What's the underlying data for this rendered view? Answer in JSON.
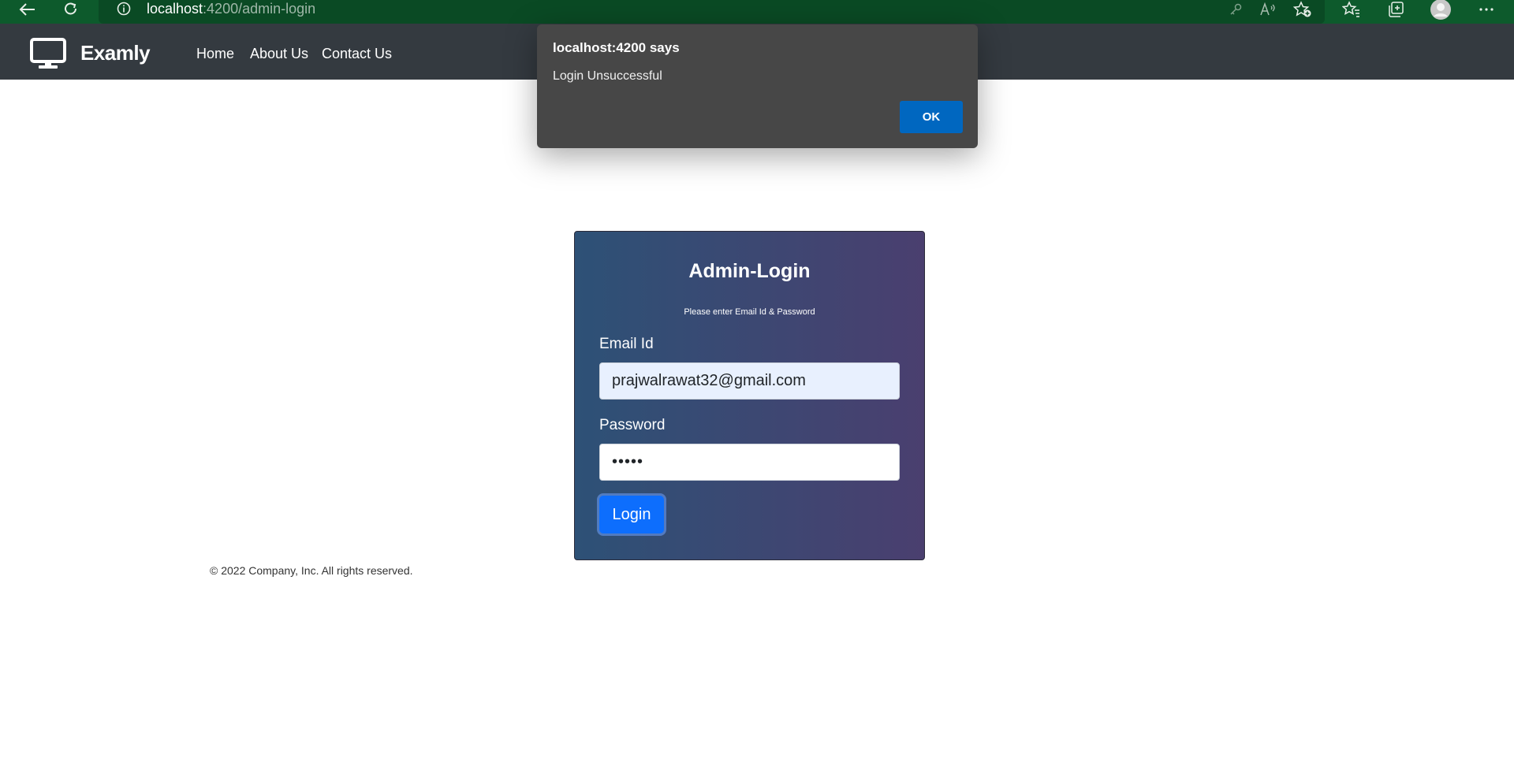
{
  "browser": {
    "url_host": "localhost",
    "url_path": ":4200/admin-login"
  },
  "navbar": {
    "brand": "Examly",
    "links": [
      "Home",
      "About Us",
      "Contact Us"
    ]
  },
  "alert": {
    "title": "localhost:4200 says",
    "message": "Login Unsuccessful",
    "ok_label": "OK"
  },
  "login": {
    "title": "Admin-Login",
    "subtitle": "Please enter Email Id & Password",
    "email_label": "Email Id",
    "email_value": "prajwalrawat32@gmail.com",
    "password_label": "Password",
    "password_value": "•••••",
    "login_label": "Login"
  },
  "footer": {
    "text": "© 2022 Company, Inc. All rights reserved."
  },
  "icons": {
    "back": "back-arrow-icon",
    "refresh": "refresh-icon",
    "info": "site-info-icon",
    "key": "key-icon",
    "read_aloud": "read-aloud-icon",
    "add_favorite": "add-favorite-icon",
    "favorites": "favorites-icon",
    "collections": "collections-icon",
    "profile": "profile-icon",
    "more": "more-icon",
    "brand": "monitor-icon"
  },
  "colors": {
    "browser_bar": "#0d5a2c",
    "navbar": "#343a40",
    "dialog": "#474747",
    "ok_button": "#0067c0",
    "card_left": "#2d5176",
    "card_right": "#4a3f6f",
    "login_button": "#0d6efd"
  }
}
